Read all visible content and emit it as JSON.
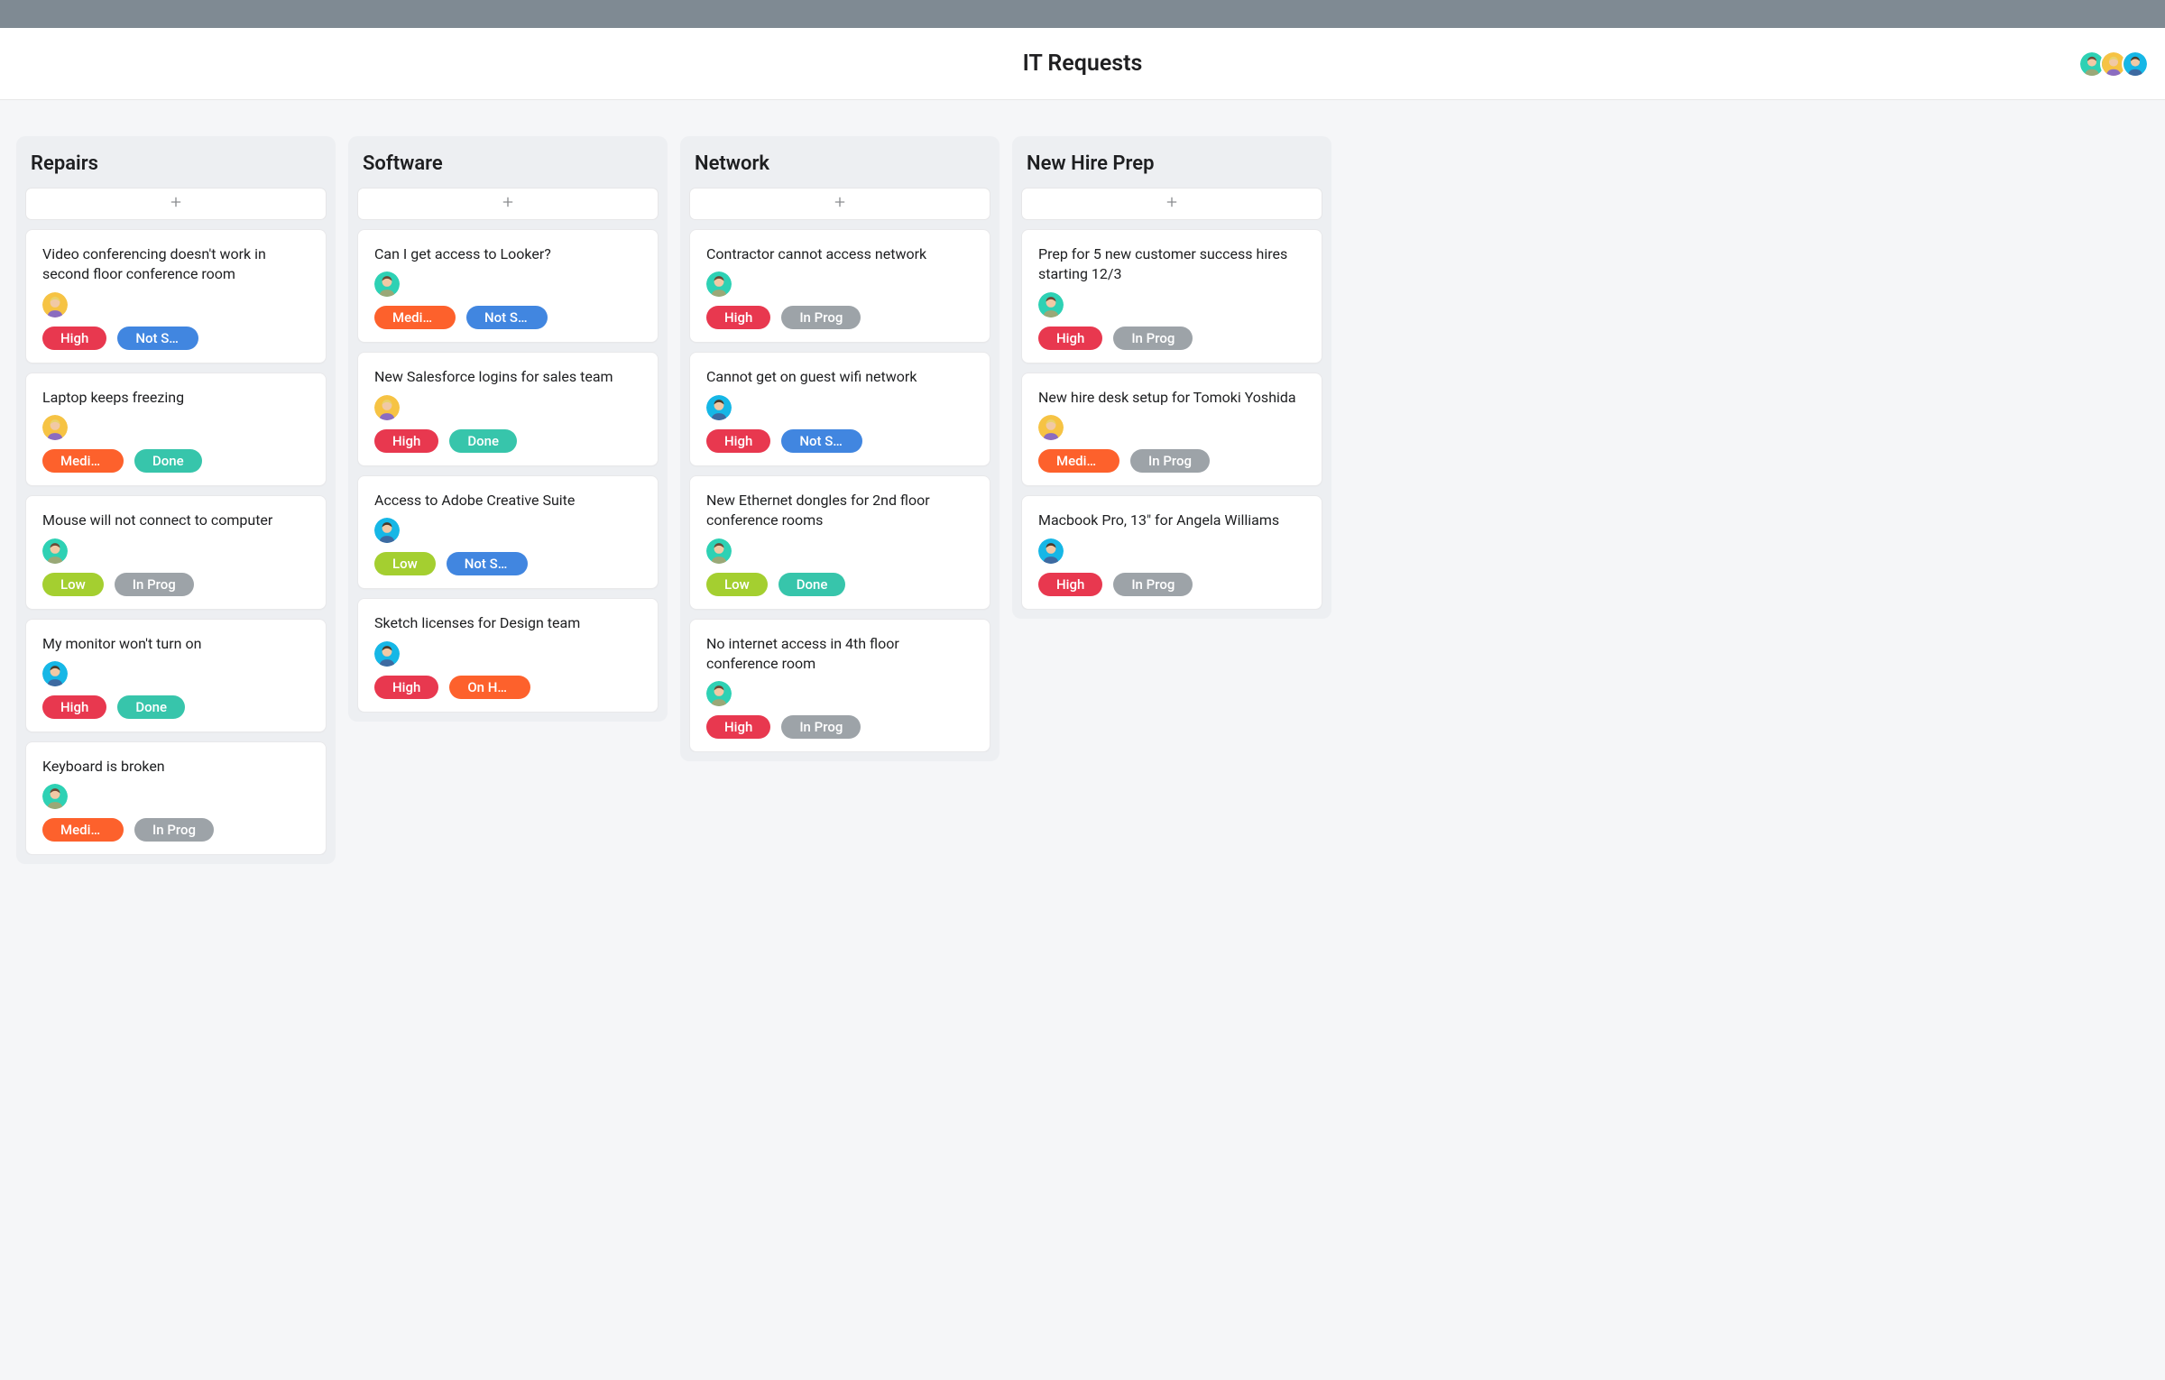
{
  "header": {
    "title": "IT Requests"
  },
  "collaborators": [
    {
      "avatar": "teal"
    },
    {
      "avatar": "yellow"
    },
    {
      "avatar": "blue"
    }
  ],
  "palette": {
    "priority": {
      "High": "#e8384f",
      "Medium": "#fd612c",
      "Low": "#a4cf30"
    },
    "status": {
      "Not Started": "#4186e0",
      "Not Star…": "#4186e0",
      "In Prog": "#9da3a8",
      "Done": "#37c5ab",
      "On Hold": "#fd612c"
    },
    "avatar": {
      "teal": "#2ed1b4",
      "yellow": "#f6c344",
      "blue": "#16b7e6"
    }
  },
  "columns": [
    {
      "title": "Repairs",
      "cards": [
        {
          "title": "Video conferencing doesn't work in second floor conference room",
          "assignee": "yellow",
          "priority": "High",
          "status": "Not Star…"
        },
        {
          "title": "Laptop keeps freezing",
          "assignee": "yellow",
          "priority": "Medium",
          "status": "Done"
        },
        {
          "title": "Mouse will not connect to computer",
          "assignee": "teal",
          "priority": "Low",
          "status": "In Prog"
        },
        {
          "title": "My monitor won't turn on",
          "assignee": "blue",
          "priority": "High",
          "status": "Done"
        },
        {
          "title": "Keyboard is broken",
          "assignee": "teal",
          "priority": "Medium",
          "status": "In Prog"
        }
      ]
    },
    {
      "title": "Software",
      "cards": [
        {
          "title": "Can I get access to Looker?",
          "assignee": "teal",
          "priority": "Medium",
          "status": "Not Star…"
        },
        {
          "title": "New Salesforce logins for sales team",
          "assignee": "yellow",
          "priority": "High",
          "status": "Done"
        },
        {
          "title": "Access to Adobe Creative Suite",
          "assignee": "blue",
          "priority": "Low",
          "status": "Not Star…"
        },
        {
          "title": "Sketch licenses for Design team",
          "assignee": "blue",
          "priority": "High",
          "status": "On Hold"
        }
      ]
    },
    {
      "title": "Network",
      "cards": [
        {
          "title": "Contractor cannot access network",
          "assignee": "teal",
          "priority": "High",
          "status": "In Prog"
        },
        {
          "title": "Cannot get on guest wifi network",
          "assignee": "blue",
          "priority": "High",
          "status": "Not Star…"
        },
        {
          "title": "New Ethernet dongles for 2nd floor conference rooms",
          "assignee": "teal",
          "priority": "Low",
          "status": "Done"
        },
        {
          "title": "No internet access in 4th floor conference room",
          "assignee": "teal",
          "priority": "High",
          "status": "In Prog"
        }
      ]
    },
    {
      "title": "New Hire Prep",
      "cards": [
        {
          "title": "Prep for 5 new customer success hires starting 12/3",
          "assignee": "teal",
          "priority": "High",
          "status": "In Prog"
        },
        {
          "title": "New hire desk setup for Tomoki Yoshida",
          "assignee": "yellow",
          "priority": "Medium",
          "status": "In Prog"
        },
        {
          "title": "Macbook Pro, 13\" for Angela Williams",
          "assignee": "blue",
          "priority": "High",
          "status": "In Prog"
        }
      ]
    }
  ]
}
